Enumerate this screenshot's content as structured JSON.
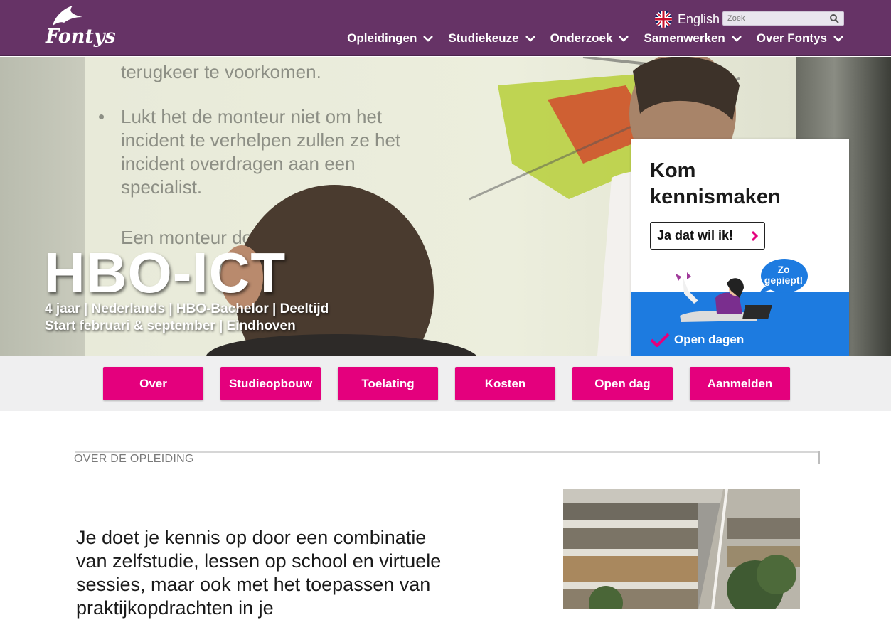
{
  "header": {
    "logo_text": "Fontys",
    "language_label": "English",
    "search_placeholder": "Zoek",
    "nav": [
      {
        "label": "Opleidingen"
      },
      {
        "label": "Studiekeuze"
      },
      {
        "label": "Onderzoek"
      },
      {
        "label": "Samenwerken"
      },
      {
        "label": "Over Fontys"
      }
    ]
  },
  "hero": {
    "title": "HBO-ICT",
    "meta_line1": "4 jaar | Nederlands  | HBO-Bachelor | Deeltijd",
    "meta_line2": "Start februari & september  | Eindhoven",
    "slide_lines": [
      "terugkeer te voorkomen.",
      "Lukt het de monteur niet om het",
      "incident te verhelpen zullen ze het",
      "incident overdragen aan een",
      "specialist.",
      "Een monteur doet eigenlij"
    ]
  },
  "promo": {
    "title_line1": "Kom",
    "title_line2": "kennismaken",
    "button_label": "Ja dat wil ik!",
    "bubble_line1": "Zo",
    "bubble_line2": "gepiept!",
    "open_days_label": "Open dagen"
  },
  "tabs": [
    {
      "label": "Over"
    },
    {
      "label": "Studieopbouw"
    },
    {
      "label": "Toelating"
    },
    {
      "label": "Kosten"
    },
    {
      "label": "Open dag"
    },
    {
      "label": "Aanmelden"
    }
  ],
  "content": {
    "section_label": "OVER DE OPLEIDING",
    "lead_text": "Je doet je kennis op door een combinatie van zelfstudie, lessen op school en virtuele sessies, maar ook met het toepassen van  praktijkopdrachten in je"
  },
  "colors": {
    "header_bg": "#663366",
    "accent_pink": "#e4007d",
    "promo_blue": "#1d7be0"
  }
}
